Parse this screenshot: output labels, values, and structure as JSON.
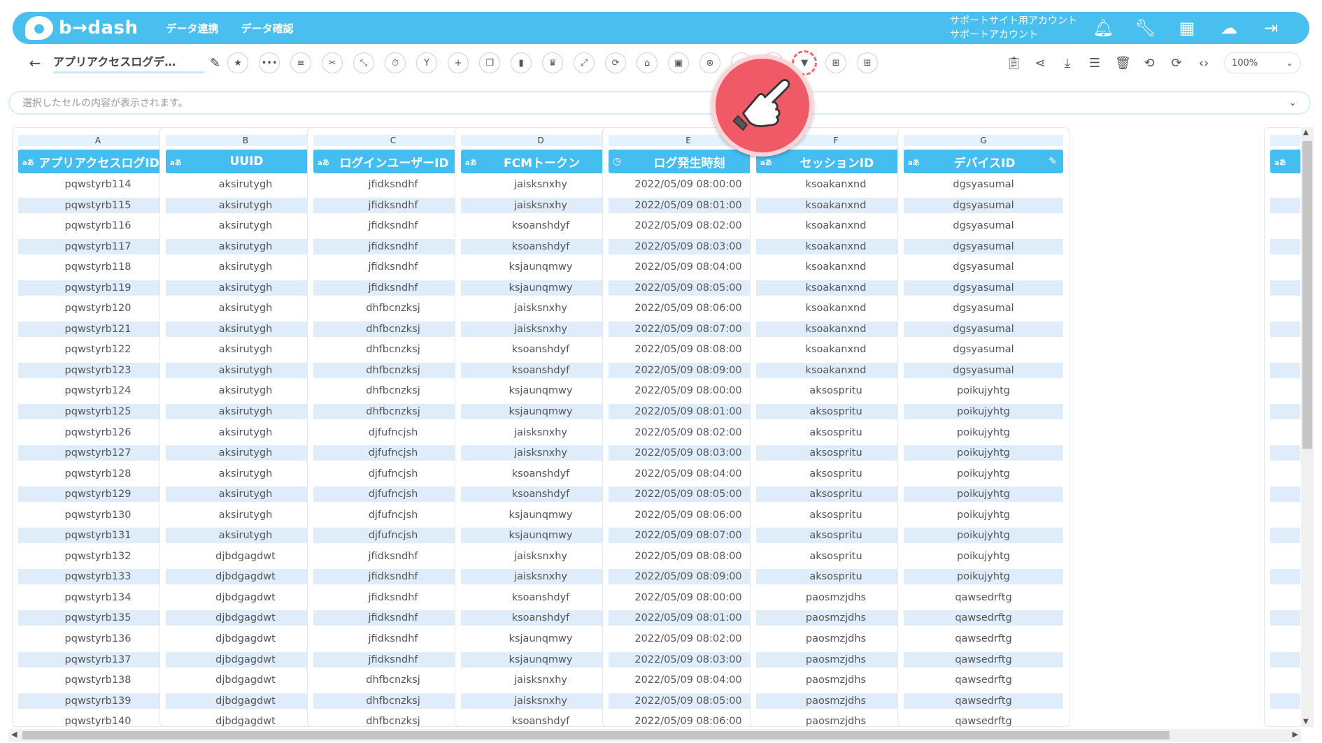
{
  "header": {
    "logo_text": "b→dash",
    "nav": [
      "データ連携",
      "データ確認"
    ],
    "account_line1": "サポートサイト用アカウント",
    "account_line2": "サポートアカウント"
  },
  "toolbar": {
    "title": "アプリアクセスログデ…",
    "zoom": "100%"
  },
  "cellbar": {
    "placeholder": "選択したセルの内容が表示されます。"
  },
  "columns": [
    {
      "letter": "A",
      "name": "アプリアクセスログID",
      "type": "aあ",
      "values": [
        "pqwstyrb114",
        "pqwstyrb115",
        "pqwstyrb116",
        "pqwstyrb117",
        "pqwstyrb118",
        "pqwstyrb119",
        "pqwstyrb120",
        "pqwstyrb121",
        "pqwstyrb122",
        "pqwstyrb123",
        "pqwstyrb124",
        "pqwstyrb125",
        "pqwstyrb126",
        "pqwstyrb127",
        "pqwstyrb128",
        "pqwstyrb129",
        "pqwstyrb130",
        "pqwstyrb131",
        "pqwstyrb132",
        "pqwstyrb133",
        "pqwstyrb134",
        "pqwstyrb135",
        "pqwstyrb136",
        "pqwstyrb137",
        "pqwstyrb138",
        "pqwstyrb139",
        "pqwstyrb140"
      ]
    },
    {
      "letter": "B",
      "name": "UUID",
      "type": "aあ",
      "values": [
        "aksirutygh",
        "aksirutygh",
        "aksirutygh",
        "aksirutygh",
        "aksirutygh",
        "aksirutygh",
        "aksirutygh",
        "aksirutygh",
        "aksirutygh",
        "aksirutygh",
        "aksirutygh",
        "aksirutygh",
        "aksirutygh",
        "aksirutygh",
        "aksirutygh",
        "aksirutygh",
        "aksirutygh",
        "aksirutygh",
        "djbdgagdwt",
        "djbdgagdwt",
        "djbdgagdwt",
        "djbdgagdwt",
        "djbdgagdwt",
        "djbdgagdwt",
        "djbdgagdwt",
        "djbdgagdwt",
        "djbdgagdwt"
      ]
    },
    {
      "letter": "C",
      "name": "ログインユーザーID",
      "type": "aあ",
      "values": [
        "jfidksndhf",
        "jfidksndhf",
        "jfidksndhf",
        "jfidksndhf",
        "jfidksndhf",
        "jfidksndhf",
        "dhfbcnzksj",
        "dhfbcnzksj",
        "dhfbcnzksj",
        "dhfbcnzksj",
        "dhfbcnzksj",
        "dhfbcnzksj",
        "djfufncjsh",
        "djfufncjsh",
        "djfufncjsh",
        "djfufncjsh",
        "djfufncjsh",
        "djfufncjsh",
        "jfidksndhf",
        "jfidksndhf",
        "jfidksndhf",
        "jfidksndhf",
        "jfidksndhf",
        "jfidksndhf",
        "dhfbcnzksj",
        "dhfbcnzksj",
        "dhfbcnzksj"
      ]
    },
    {
      "letter": "D",
      "name": "FCMトークン",
      "type": "aあ",
      "values": [
        "jaisksnxhy",
        "jaisksnxhy",
        "ksoanshdyf",
        "ksoanshdyf",
        "ksjaunqmwy",
        "ksjaunqmwy",
        "jaisksnxhy",
        "jaisksnxhy",
        "ksoanshdyf",
        "ksoanshdyf",
        "ksjaunqmwy",
        "ksjaunqmwy",
        "jaisksnxhy",
        "jaisksnxhy",
        "ksoanshdyf",
        "ksoanshdyf",
        "ksjaunqmwy",
        "ksjaunqmwy",
        "jaisksnxhy",
        "jaisksnxhy",
        "ksoanshdyf",
        "ksoanshdyf",
        "ksjaunqmwy",
        "ksjaunqmwy",
        "jaisksnxhy",
        "jaisksnxhy",
        "ksoanshdyf"
      ]
    },
    {
      "letter": "E",
      "name": "ログ発生時刻",
      "type": "clock",
      "values": [
        "2022/05/09 08:00:00",
        "2022/05/09 08:01:00",
        "2022/05/09 08:02:00",
        "2022/05/09 08:03:00",
        "2022/05/09 08:04:00",
        "2022/05/09 08:05:00",
        "2022/05/09 08:06:00",
        "2022/05/09 08:07:00",
        "2022/05/09 08:08:00",
        "2022/05/09 08:09:00",
        "2022/05/09 08:00:00",
        "2022/05/09 08:01:00",
        "2022/05/09 08:02:00",
        "2022/05/09 08:03:00",
        "2022/05/09 08:04:00",
        "2022/05/09 08:05:00",
        "2022/05/09 08:06:00",
        "2022/05/09 08:07:00",
        "2022/05/09 08:08:00",
        "2022/05/09 08:09:00",
        "2022/05/09 08:00:00",
        "2022/05/09 08:01:00",
        "2022/05/09 08:02:00",
        "2022/05/09 08:03:00",
        "2022/05/09 08:04:00",
        "2022/05/09 08:05:00",
        "2022/05/09 08:06:00"
      ]
    },
    {
      "letter": "F",
      "name": "セッションID",
      "type": "aあ",
      "values": [
        "ksoakanxnd",
        "ksoakanxnd",
        "ksoakanxnd",
        "ksoakanxnd",
        "ksoakanxnd",
        "ksoakanxnd",
        "ksoakanxnd",
        "ksoakanxnd",
        "ksoakanxnd",
        "ksoakanxnd",
        "aksospritu",
        "aksospritu",
        "aksospritu",
        "aksospritu",
        "aksospritu",
        "aksospritu",
        "aksospritu",
        "aksospritu",
        "aksospritu",
        "aksospritu",
        "paosmzjdhs",
        "paosmzjdhs",
        "paosmzjdhs",
        "paosmzjdhs",
        "paosmzjdhs",
        "paosmzjdhs",
        "paosmzjdhs"
      ]
    },
    {
      "letter": "G",
      "name": "デバイスID",
      "type": "aあ",
      "values": [
        "dgsyasumal",
        "dgsyasumal",
        "dgsyasumal",
        "dgsyasumal",
        "dgsyasumal",
        "dgsyasumal",
        "dgsyasumal",
        "dgsyasumal",
        "dgsyasumal",
        "dgsyasumal",
        "poikujyhtg",
        "poikujyhtg",
        "poikujyhtg",
        "poikujyhtg",
        "poikujyhtg",
        "poikujyhtg",
        "poikujyhtg",
        "poikujyhtg",
        "poikujyhtg",
        "poikujyhtg",
        "qawsedrftg",
        "qawsedrftg",
        "qawsedrftg",
        "qawsedrftg",
        "qawsedrftg",
        "qawsedrftg",
        "qawsedrftg"
      ]
    }
  ],
  "partial_column": {
    "type": "aあ",
    "rows": 27
  },
  "colors": {
    "header_blue": "#49bff0",
    "column_header": "#44bdf0",
    "row_alt": "#deedf9",
    "pointer_red": "#f05a66",
    "highlight_dash": "#f0686e"
  }
}
